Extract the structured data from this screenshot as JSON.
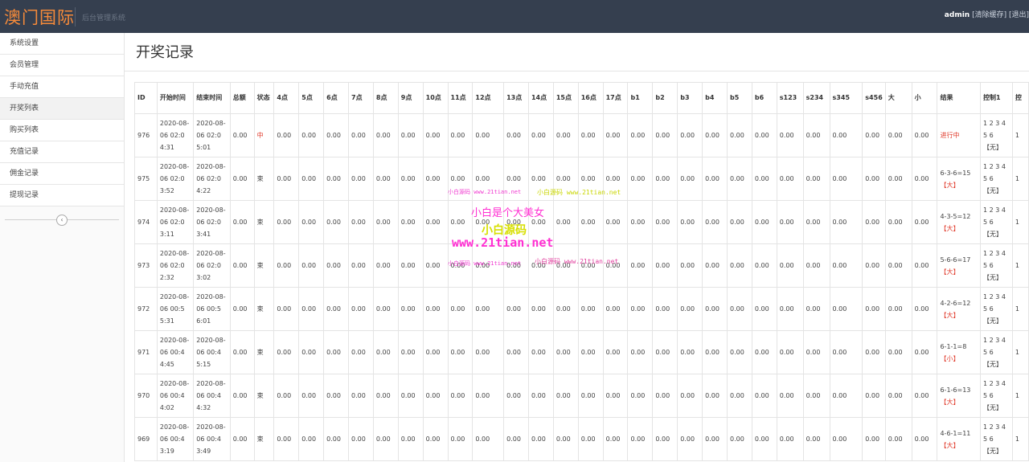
{
  "header": {
    "logo": "澳门国际",
    "subtitle": "后台管理系统",
    "user": "admin",
    "clear_cache": "[清除缓存]",
    "logout": "[退出]"
  },
  "sidebar": {
    "items": [
      {
        "label": "系统设置"
      },
      {
        "label": "会员管理"
      },
      {
        "label": "手动充值"
      },
      {
        "label": "开奖列表"
      },
      {
        "label": "购买列表"
      },
      {
        "label": "充值记录"
      },
      {
        "label": "佣金记录"
      },
      {
        "label": "提现记录"
      }
    ],
    "collapse_icon": "chevron-left-icon"
  },
  "page": {
    "title": "开奖记录"
  },
  "table": {
    "columns": [
      "ID",
      "开始时间",
      "结束时间",
      "总额",
      "状态",
      "4点",
      "5点",
      "6点",
      "7点",
      "8点",
      "9点",
      "10点",
      "11点",
      "12点",
      "13点",
      "14点",
      "15点",
      "16点",
      "17点",
      "b1",
      "b2",
      "b3",
      "b4",
      "b5",
      "b6",
      "s123",
      "s234",
      "s345",
      "s456",
      "大",
      "小",
      "结果",
      "控制1",
      "控"
    ],
    "rows": [
      {
        "id": "976",
        "start": "2020-08-06 02:04:31",
        "end": "2020-08-06 02:05:01",
        "total": "0.00",
        "state": "中",
        "result": "进行中",
        "ctrl": "1 2 3 4 5 6 【无】"
      },
      {
        "id": "975",
        "start": "2020-08-06 02:03:52",
        "end": "2020-08-06 02:04:22",
        "total": "0.00",
        "state": "束",
        "result": "6-3-6=15【大】",
        "ctrl": "1 2 3 4 5 6 【无】"
      },
      {
        "id": "974",
        "start": "2020-08-06 02:03:11",
        "end": "2020-08-06 02:03:41",
        "total": "0.00",
        "state": "束",
        "result": "4-3-5=12【大】",
        "ctrl": "1 2 3 4 5 6 【无】"
      },
      {
        "id": "973",
        "start": "2020-08-06 02:02:32",
        "end": "2020-08-06 02:03:02",
        "total": "0.00",
        "state": "束",
        "result": "5-6-6=17【大】",
        "ctrl": "1 2 3 4 5 6 【无】"
      },
      {
        "id": "972",
        "start": "2020-08-06 00:55:31",
        "end": "2020-08-06 00:56:01",
        "total": "0.00",
        "state": "束",
        "result": "4-2-6=12【大】",
        "ctrl": "1 2 3 4 5 6 【无】"
      },
      {
        "id": "971",
        "start": "2020-08-06 00:44:45",
        "end": "2020-08-06 00:45:15",
        "total": "0.00",
        "state": "束",
        "result": "6-1-1=8【小】",
        "ctrl": "1 2 3 4 5 6 【无】"
      },
      {
        "id": "970",
        "start": "2020-08-06 00:44:02",
        "end": "2020-08-06 00:44:32",
        "total": "0.00",
        "state": "束",
        "result": "6-1-6=13【大】",
        "ctrl": "1 2 3 4 5 6 【无】"
      },
      {
        "id": "969",
        "start": "2020-08-06 00:43:19",
        "end": "2020-08-06 00:43:49",
        "total": "0.00",
        "state": "束",
        "result": "4-6-1=11【大】",
        "ctrl": "1 2 3 4 5 6 【无】"
      }
    ],
    "cell_value": "0.00",
    "truncated_ctrl": "1"
  },
  "watermark": {
    "a": "小白源码 www.21tian.net",
    "b": "小白源码 www.21tian.net",
    "c": "小白是个大美女",
    "d": "小白源码",
    "e": "www.21tian.net",
    "f": "小白源码 www.21tian.net",
    "g": "小白源码 www.21tian.net"
  },
  "colors": {
    "topbar": "#353f4f",
    "logo": "#f58a3a",
    "accent_red": "#e03b2c"
  }
}
